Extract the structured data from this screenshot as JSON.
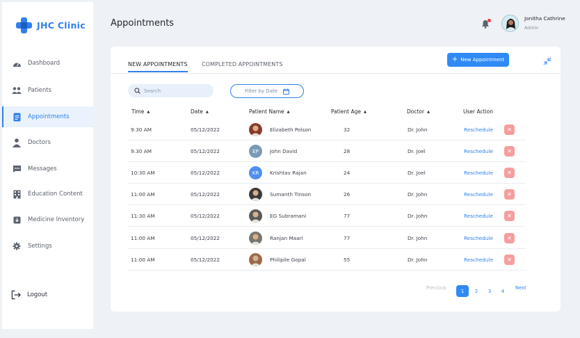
{
  "brand": {
    "name": "JHC Clinic",
    "color": "#2f80ed"
  },
  "sidebar": {
    "items": [
      {
        "label": "Dashboard",
        "icon": "dashboard-gauge-icon",
        "active": false
      },
      {
        "label": "Patients",
        "icon": "patients-group-icon",
        "active": false
      },
      {
        "label": "Appointments",
        "icon": "appointments-document-icon",
        "active": true
      },
      {
        "label": "Doctors",
        "icon": "doctor-icon",
        "active": false
      },
      {
        "label": "Messages",
        "icon": "message-bubble-icon",
        "active": false
      },
      {
        "label": "Education Content",
        "icon": "building-icon",
        "active": false
      },
      {
        "label": "Medicine Inventory",
        "icon": "inventory-box-icon",
        "active": false
      },
      {
        "label": "Settings",
        "icon": "gear-icon",
        "active": false
      }
    ],
    "logout_label": "Logout"
  },
  "header": {
    "title": "Appointments",
    "user": {
      "name": "Jonitha Cathrine",
      "role": "Admin"
    }
  },
  "tabs": [
    {
      "label": "NEW APPOINTMENTS",
      "active": true
    },
    {
      "label": "COMPLETED APPOINTMENTS",
      "active": false
    }
  ],
  "new_button_label": "New Appointment",
  "search": {
    "placeholder": "Search",
    "value": ""
  },
  "filter_label": "Filter by Date",
  "table": {
    "columns": [
      "Time",
      "Date",
      "Patient Name",
      "Patient Age",
      "Doctor",
      "User Action"
    ],
    "action_label": "Reschedule",
    "rows": [
      {
        "time": "9:30 AM",
        "date": "05/12/2022",
        "name": "Elizabeth Polson",
        "age": "32",
        "doctor": "Dr. John",
        "initials": "",
        "avatar_color": "#8a3a2a"
      },
      {
        "time": "9:30 AM",
        "date": "05/12/2022",
        "name": "John David",
        "age": "28",
        "doctor": "Dr. Joel",
        "initials": "EP",
        "avatar_color": "#7a9bb8"
      },
      {
        "time": "10:30 AM",
        "date": "05/12/2022",
        "name": "Krishtav Rajan",
        "age": "24",
        "doctor": "Dr. Joel",
        "initials": "KR",
        "avatar_color": "#4f8ef0"
      },
      {
        "time": "11:00 AM",
        "date": "05/12/2022",
        "name": "Sumanth Tinson",
        "age": "26",
        "doctor": "Dr. John",
        "initials": "",
        "avatar_color": "#3a3a3a"
      },
      {
        "time": "11:30 AM",
        "date": "05/12/2022",
        "name": "EG Subramani",
        "age": "77",
        "doctor": "Dr. John",
        "initials": "",
        "avatar_color": "#5a5a5a"
      },
      {
        "time": "11:00 AM",
        "date": "05/12/2022",
        "name": "Ranjan Maari",
        "age": "77",
        "doctor": "Dr. John",
        "initials": "",
        "avatar_color": "#7a7570"
      },
      {
        "time": "11:00 AM",
        "date": "05/12/2022",
        "name": "Philipile Gopal",
        "age": "55",
        "doctor": "Dr. John",
        "initials": "",
        "avatar_color": "#9a6a4a"
      }
    ]
  },
  "pagination": {
    "previous_label": "Previous",
    "pages": [
      "1",
      "2",
      "3",
      "4"
    ],
    "current": "1",
    "next_label": "Next"
  },
  "colors": {
    "accent": "#2f80ed",
    "delete": "#f59e9e",
    "notification_dot": "#ee3b3b"
  }
}
